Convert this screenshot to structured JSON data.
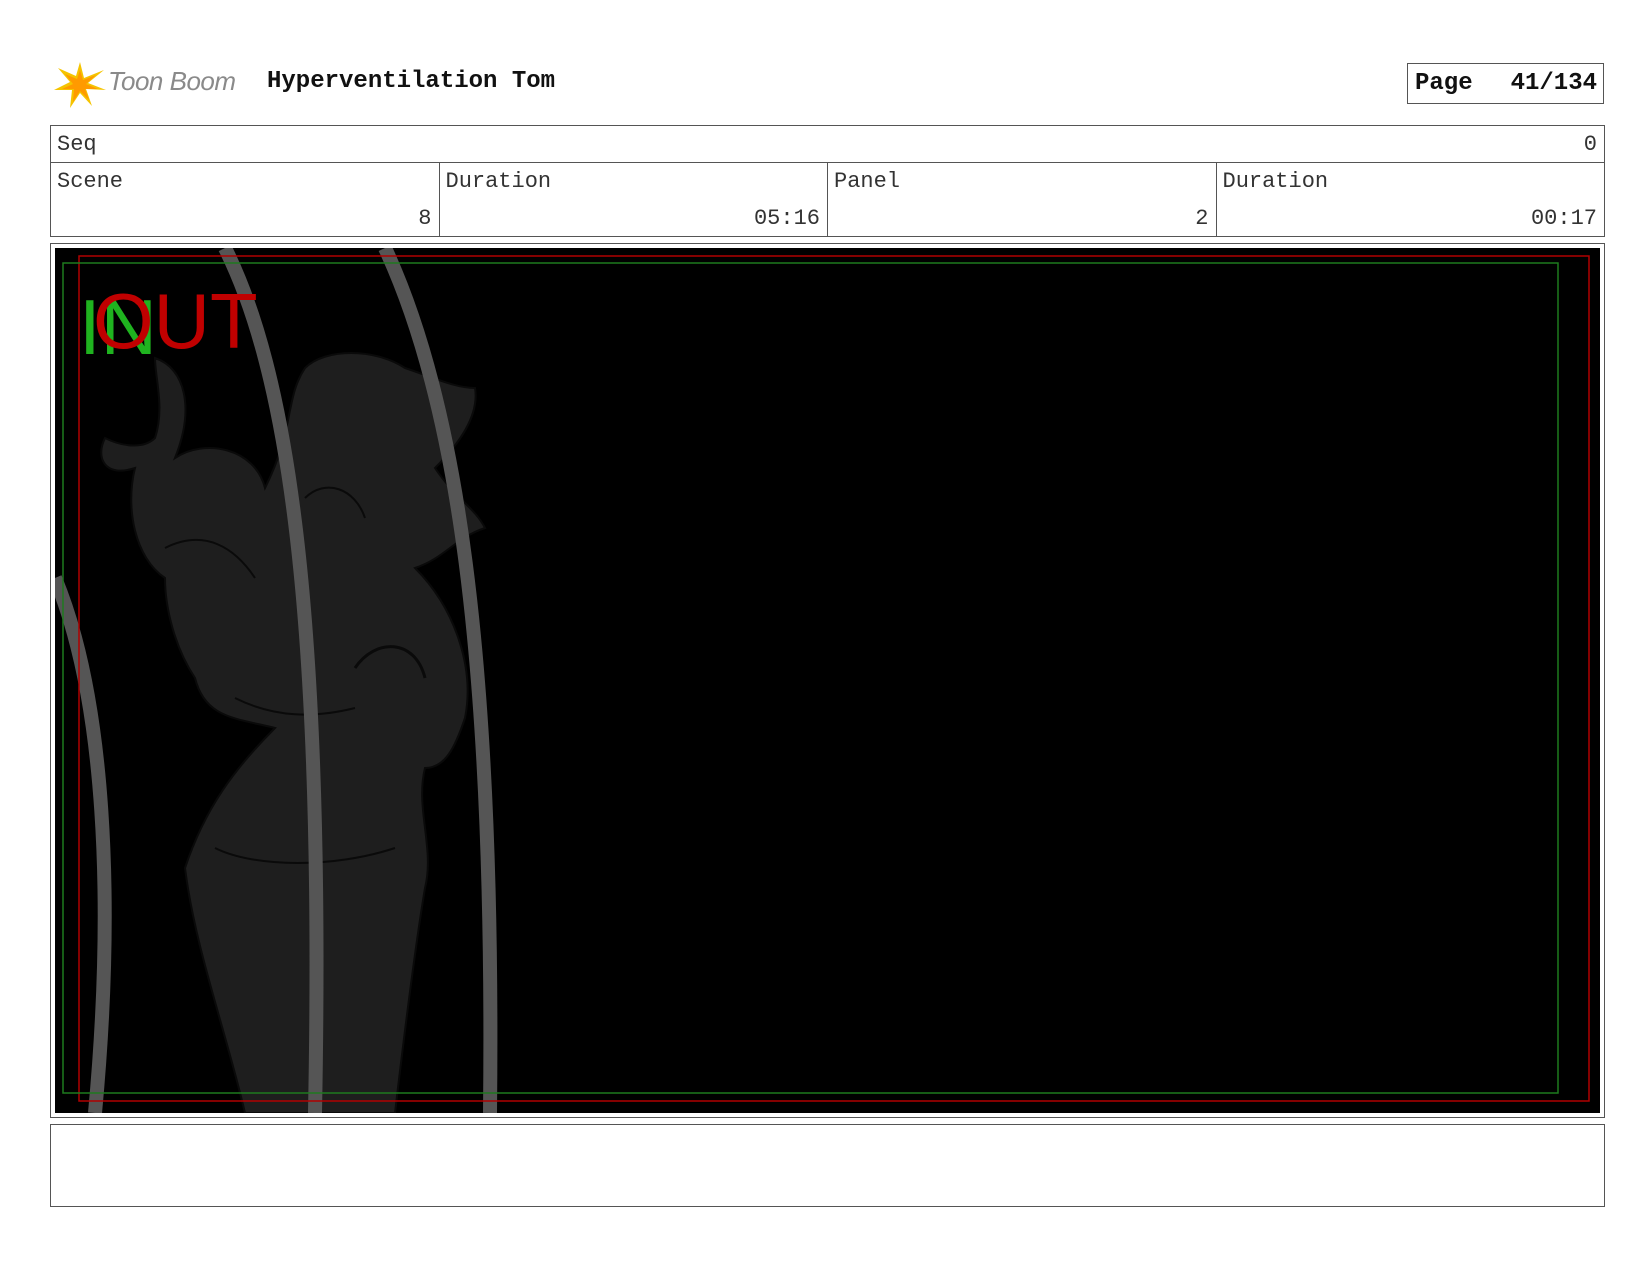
{
  "header": {
    "logo_text": "Toon Boom",
    "project_title": "Hyperventilation Tom",
    "page_label": "Page",
    "page_value": "41/134"
  },
  "info": {
    "seq_label": "Seq",
    "seq_value": "0",
    "scene_label": "Scene",
    "scene_value": "8",
    "scene_duration_label": "Duration",
    "scene_duration_value": "05:16",
    "panel_label": "Panel",
    "panel_value": "2",
    "panel_duration_label": "Duration",
    "panel_duration_value": "00:17"
  },
  "panel": {
    "in_marker": "IN",
    "out_marker": "OUT",
    "colors": {
      "background": "#000000",
      "in_color": "#1fb31f",
      "out_color": "#c00000",
      "title_safe": "#1e7a1e",
      "action_safe": "#b00000",
      "sketch_fill": "#1e1e1e",
      "stroke": "#555555"
    }
  },
  "caption": {
    "text": ""
  }
}
